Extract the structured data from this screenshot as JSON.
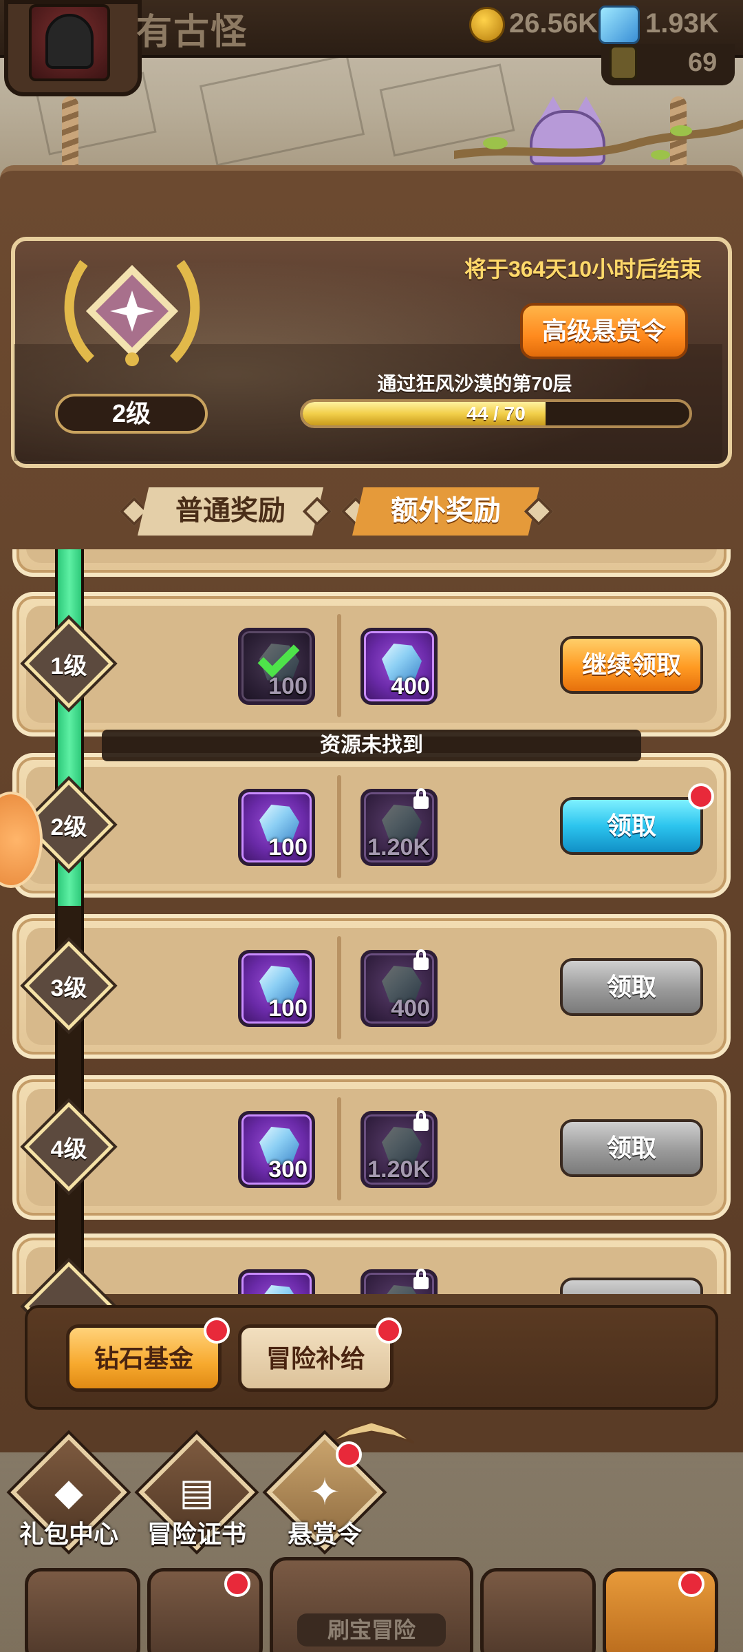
{
  "header": {
    "username": "有古怪",
    "gold": "26.56K",
    "gems": "1.93K",
    "stamina": "69"
  },
  "banner": {
    "end_text": "将于364天10小时后结束",
    "premium_button": "高级悬赏令",
    "level": "2级",
    "quest": "通过狂风沙漠的第70层",
    "progress_text": "44 / 70",
    "progress_current": 44,
    "progress_total": 70
  },
  "tabs": {
    "normal": "普通奖励",
    "extra": "额外奖励"
  },
  "rows": [
    {
      "level": "1级",
      "free_amount": "100",
      "free_state": "claimed",
      "extra_amount": "400",
      "extra_state": "available",
      "button": "继续领取",
      "button_style": "orange",
      "dot": false
    },
    {
      "level": "2级",
      "free_amount": "100",
      "free_state": "available",
      "extra_amount": "1.20K",
      "extra_state": "locked",
      "button": "领取",
      "button_style": "blue",
      "dot": true
    },
    {
      "level": "3级",
      "free_amount": "100",
      "free_state": "available",
      "extra_amount": "400",
      "extra_state": "locked",
      "button": "领取",
      "button_style": "gray",
      "dot": false
    },
    {
      "level": "4级",
      "free_amount": "300",
      "free_state": "available",
      "extra_amount": "1.20K",
      "extra_state": "locked",
      "button": "领取",
      "button_style": "gray",
      "dot": false
    }
  ],
  "toast": "资源未找到",
  "subtabs": {
    "diamond_fund": "钻石基金",
    "adventure_supply": "冒险补给"
  },
  "nav": {
    "gift_center": "礼包中心",
    "adventure_cert": "冒险证书",
    "bounty": "悬赏令"
  },
  "dock": {
    "center_label": "刷宝冒险"
  },
  "icons": {
    "gold": "gold-coin-icon",
    "gem": "gem-icon",
    "stamina": "stamina-icon",
    "reward": "gem-crystal-icon",
    "locked": "lock-icon",
    "claimed": "check-icon",
    "gift": "diamond-icon",
    "cert": "book-icon",
    "bounty": "bounty-icon"
  },
  "colors": {
    "accent_orange": "#ff9a22",
    "claim_blue": "#2cc4ee",
    "track_green": "#5ef0a4",
    "notify_red": "#e8293a"
  }
}
